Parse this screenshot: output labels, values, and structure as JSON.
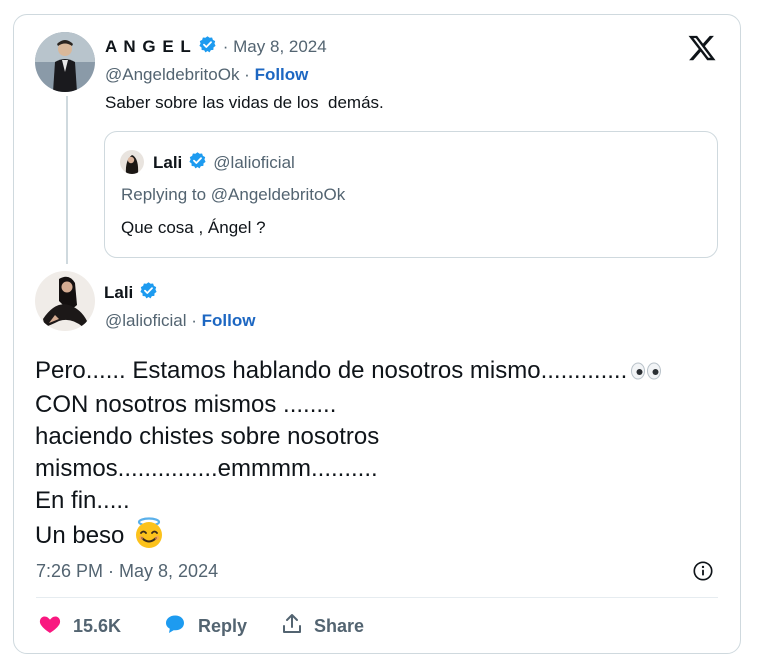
{
  "main_tweet": {
    "author_name": "A N G E L",
    "date": "· May 8, 2024",
    "handle": "@AngeldebritoOk",
    "separator": " · ",
    "follow_label": "Follow",
    "text": "Saber sobre las vidas de los  demás."
  },
  "quoted_tweet": {
    "author_name": "Lali",
    "handle": "@lalioficial",
    "replying_to": "Replying to @AngeldebritoOk",
    "text": "Que cosa , Ángel ?"
  },
  "reply_tweet": {
    "author_name": "Lali",
    "handle": "@lalioficial",
    "separator": " · ",
    "follow_label": "Follow",
    "body_lines": [
      "Pero...... Estamos hablando de nosotros mismo.............",
      "CON nosotros mismos ........",
      "haciendo chistes sobre nosotros",
      "mismos...............emmmm..........",
      "En fin.....",
      "Un beso"
    ],
    "timestamp": "7:26 PM · May 8, 2024"
  },
  "actions": {
    "likes": "15.6K",
    "reply_label": "Reply",
    "share_label": "Share"
  },
  "colors": {
    "verified": "#1d9bf0",
    "like": "#f91880",
    "link": "#1d67c2",
    "muted": "#536471",
    "border": "#cfd9de"
  },
  "icons": [
    "verified-badge-icon",
    "x-logo-icon",
    "info-icon",
    "heart-icon",
    "reply-bubble-icon",
    "share-icon",
    "eyes-emoji-icon",
    "halo-smile-emoji-icon"
  ]
}
